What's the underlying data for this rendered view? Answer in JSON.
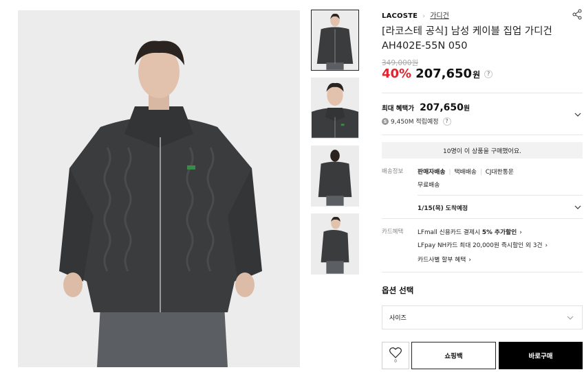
{
  "product": {
    "brand": "LACOSTE",
    "category": "가디건",
    "title": "[라코스테 공식] 남성 케이블 집업 가디건 AH402E-55N 050",
    "original_price": "349,000원",
    "discount": "40%",
    "price": "207,650",
    "currency": "원"
  },
  "benefit": {
    "label": "최대 혜택가",
    "price": "207,650",
    "currency": "원",
    "coin_icon": "S",
    "points": "9,450M 적립예정"
  },
  "buyers_banner": "10명이 이 상품을 구매했어요.",
  "shipping": {
    "label": "배송정보",
    "type": "판매자배송",
    "method": "택배배송",
    "carrier": "CJ대한통운",
    "fee": "무료배송",
    "arrival": "1/15(목) 도착예정"
  },
  "card": {
    "label": "카드혜택",
    "line1_prefix": "LFmall 신용카드 결제시 ",
    "line1_bold": "5% 추가할인",
    "line2": "LFpay NH카드 최대 20,000원 즉시할인 외 3건",
    "line3": "카드사별 할부 혜택"
  },
  "options": {
    "title": "옵션 선택",
    "size_placeholder": "사이즈"
  },
  "buttons": {
    "wish_count": "0",
    "cart": "쇼핑백",
    "buy": "바로구매"
  },
  "colors": {
    "discount": "#e1232d",
    "buy_button": "#000000",
    "banner_bg": "#f2f2f2"
  },
  "icons": {
    "share": "share-icon",
    "question": "?",
    "chevron": "chevron-down-icon",
    "arrow": "›",
    "heart": "heart-icon"
  }
}
